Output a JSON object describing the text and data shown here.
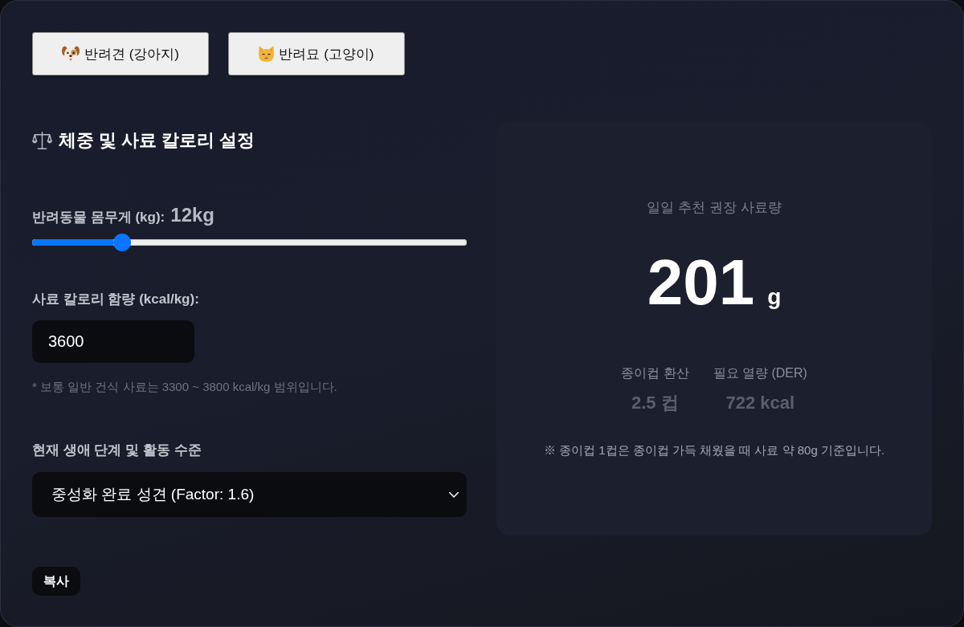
{
  "pets": [
    {
      "kind": "dog",
      "label": "반려견 (강아지)",
      "selected": false
    },
    {
      "kind": "cat",
      "label": "반려묘 (고양이)",
      "selected": false
    }
  ],
  "settings": {
    "title": "체중 및 사료 칼로리 설정",
    "weight": {
      "label": "반려동물 몸무게 (kg):",
      "reading": "12kg",
      "level": 0.195
    },
    "calorie": {
      "label": "사료 칼로리 함량 (kcal/kg):",
      "value": "3600",
      "hint": "* 보통 일반 건식 사료는 3300 ~ 3800 kcal/kg 범위입니다."
    },
    "life_stage": {
      "label": "현재 생애 단계 및 활동 수준",
      "value": "중성화 완료 성견 (Factor: 1.6)"
    }
  },
  "result": {
    "title": "일일 추천 권장 사료량",
    "amount": "201",
    "unit": "g",
    "stats": [
      {
        "label": "종이컵 환산",
        "value": "2.5 컵"
      },
      {
        "label": "필요 열량 (DER)",
        "value": "722 kcal"
      }
    ],
    "note": "※ 종이컵 1컵은 종이컵 가득 채웠을 때 사료 약 80g 기준입니다."
  },
  "copy_button": "복사"
}
